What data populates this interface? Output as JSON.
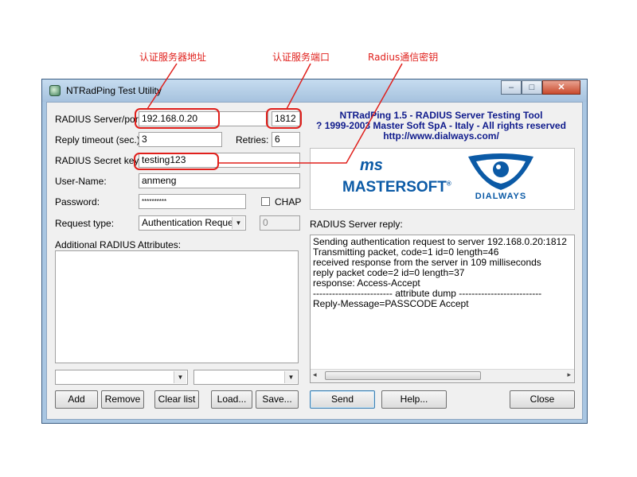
{
  "annotations": {
    "server_address": "认证服务器地址",
    "server_port": "认证服务端口",
    "secret": "Radius通信密钥"
  },
  "window": {
    "title": "NTRadPing Test Utility",
    "minimize": "–",
    "maximize": "□",
    "close": "✕"
  },
  "form": {
    "server_label": "RADIUS Server/port:",
    "server_value": "192.168.0.20",
    "port_value": "1812",
    "timeout_label": "Reply timeout (sec.):",
    "timeout_value": "3",
    "retries_label": "Retries:",
    "retries_value": "6",
    "secret_label": "RADIUS Secret key:",
    "secret_value": "testing123",
    "username_label": "User-Name:",
    "username_value": "anmeng",
    "password_label": "Password:",
    "password_value": "**********",
    "chap_label": "CHAP",
    "chap_checked": false,
    "request_type_label": "Request type:",
    "request_type_value": "Authentication Request",
    "request_id_value": "0",
    "attributes_label": "Additional RADIUS Attributes:"
  },
  "header_info": {
    "line1": "NTRadPing 1.5 - RADIUS Server Testing Tool",
    "line2": "? 1999-2003 Master Soft SpA - Italy - All rights reserved",
    "line3": "http://www.dialways.com/",
    "color": "#0f1b8c"
  },
  "logos": {
    "mastersoft_ms": "ms",
    "mastersoft_name": "MASTERSOFT",
    "mastersoft_reg": "®",
    "dialways_name": "DIALWAYS",
    "brand_blue": "#0b5aa6"
  },
  "reply": {
    "label": "RADIUS Server reply:",
    "lines": [
      "Sending authentication request to server 192.168.0.20:1812",
      "Transmitting packet, code=1 id=0 length=46",
      "received response from the server in 109 milliseconds",
      "reply packet code=2 id=0 length=37",
      "response: Access-Accept",
      "------------------------- attribute dump --------------------------",
      "Reply-Message=PASSCODE Accept"
    ]
  },
  "buttons": {
    "add": "Add",
    "remove": "Remove",
    "clear": "Clear list",
    "load": "Load...",
    "save": "Save...",
    "send": "Send",
    "help": "Help...",
    "close": "Close"
  },
  "colors": {
    "annotation_red": "#e0201c",
    "window_frame": "#a9c6e2"
  }
}
